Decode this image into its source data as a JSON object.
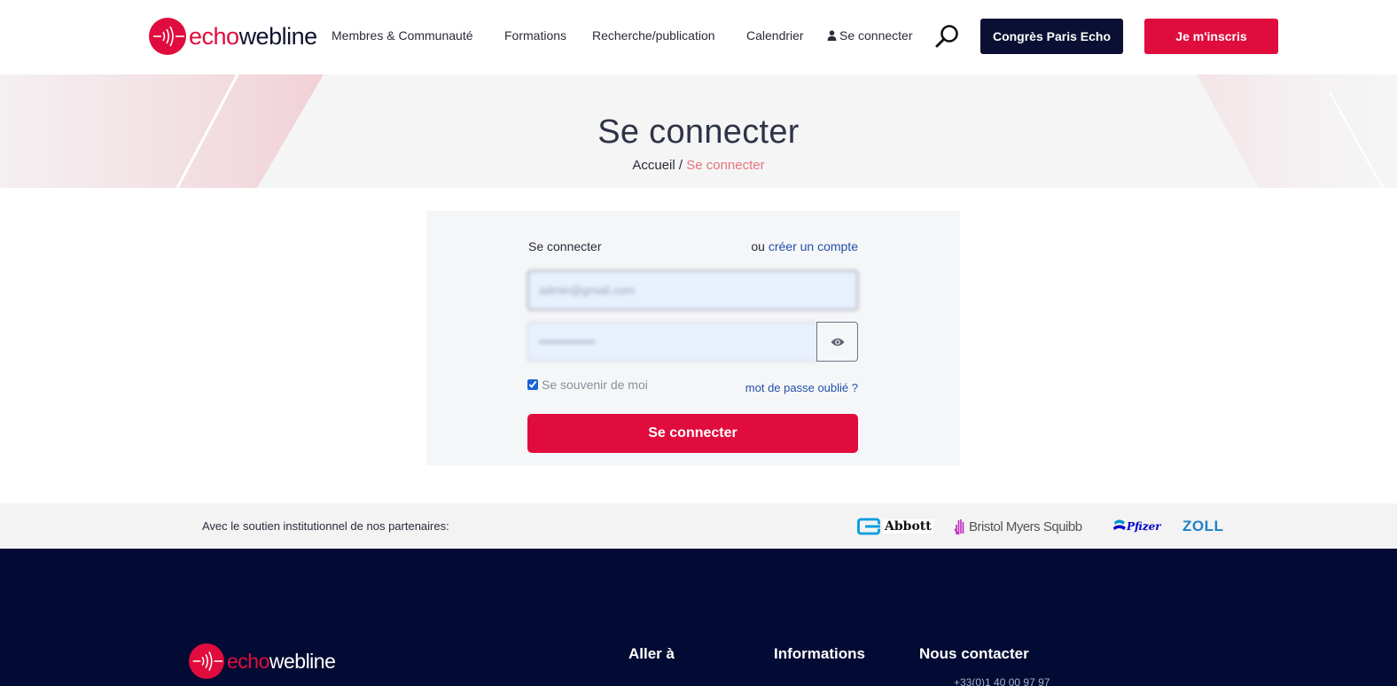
{
  "brand": {
    "name_part1": "echo",
    "name_part2": "webline",
    "accent": "#e00c3d",
    "dark": "#0a0f33"
  },
  "nav": {
    "items": [
      "Membres & Communauté",
      "Formations",
      "Recherche/publication",
      "Calendrier"
    ],
    "login": "Se connecter",
    "search_icon": "search-icon",
    "congress_button": "Congrès Paris Echo",
    "signup_button": "Je m'inscris"
  },
  "hero": {
    "title": "Se connecter",
    "breadcrumb_home": "Accueil",
    "breadcrumb_sep": "/",
    "breadcrumb_current": "Se connecter"
  },
  "login": {
    "heading": "Se connecter",
    "alt_prefix": "ou",
    "alt_link": "créer un compte",
    "email_value": "admin@gmail.com",
    "password_value": "••••••••••••••",
    "remember_label": "Se souvenir de moi",
    "remember_checked": true,
    "forgot_link": "mot de passe oublié ?",
    "submit_label": "Se connecter"
  },
  "partners": {
    "label": "Avec le soutien institutionnel de nos partenaires:",
    "logos": [
      "Abbott",
      "Bristol Myers Squibb",
      "Pfizer",
      "ZOLL"
    ]
  },
  "footer": {
    "col1": "Aller à",
    "col2": "Informations",
    "col3": "Nous contacter",
    "phone": "+33(0)1 40 00 97 97"
  }
}
